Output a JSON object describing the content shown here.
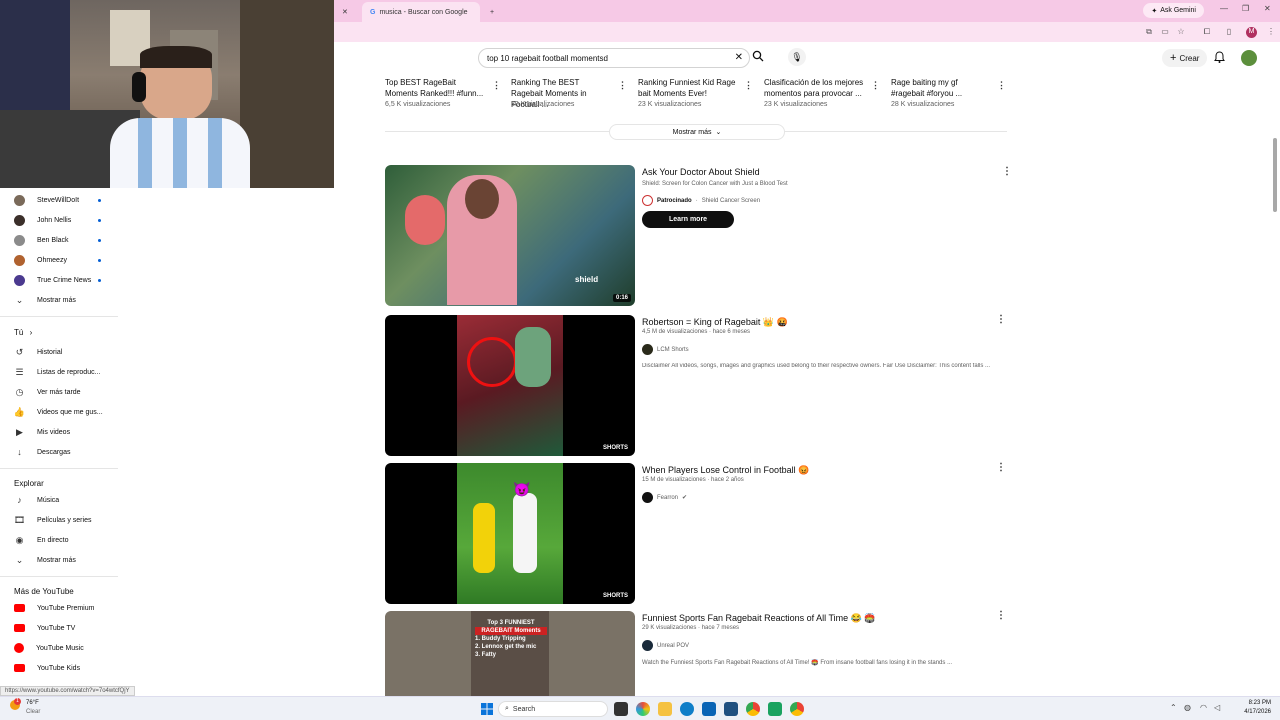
{
  "browser": {
    "tabs": [
      {
        "label": "Buscar con Google",
        "active": false,
        "prefix": "musica"
      },
      {
        "label": "×",
        "active": true
      }
    ],
    "gemini_label": "Ask Gemini",
    "new_tab": "+"
  },
  "youtube": {
    "search_value": "top 10 ragebait football momentsd",
    "create_label": "Crear",
    "shelf": [
      {
        "title": "Top BEST RageBait Moments Ranked!!! #funn...",
        "views": "6,5 K visualizaciones"
      },
      {
        "title": "Ranking The BEST Ragebait Moments in Football ...",
        "views": "30 K visualizaciones"
      },
      {
        "title": "Ranking Funniest Kid Rage bait Moments Ever!",
        "views": "23 K visualizaciones"
      },
      {
        "title": "Clasificación de los mejores momentos para provocar ...",
        "views": "23 K visualizaciones"
      },
      {
        "title": "Rage baiting my gf #ragebait #foryou ...",
        "views": "28 K visualizaciones"
      }
    ],
    "show_more": "Mostrar más",
    "results": [
      {
        "title": "Ask Your Doctor About Shield",
        "subtitle": "Shield: Screen for Colon Cancer with Just a Blood Test",
        "sponsor": "Patrocinado",
        "channel": "Shield Cancer Screen",
        "cta": "Learn more",
        "duration": "0:16"
      },
      {
        "title": "Robertson = King of Ragebait 👑 🤬",
        "meta": "4,5 M de visualizaciones · hace 6 meses",
        "channel": "LCM Shorts",
        "desc": "Disclaimer All videos, songs, images and graphics used belong to their respective owners. Fair Use Disclaimer: This content falls ...",
        "badge": "SHORTS"
      },
      {
        "title": "When Players Lose Control in Football 😡",
        "meta": "15 M de visualizaciones · hace 2 años",
        "channel": "Fearron",
        "badge": "SHORTS"
      },
      {
        "title": "Funniest Sports Fan Ragebait Reactions of All Time 😂 🏟️",
        "meta": "29 K visualizaciones · hace 7 meses",
        "channel": "Unreal POV",
        "desc": "Watch the Funniest Sports Fan Ragebait Reactions of All Time! 🏟️ From insane football fans losing it in the stands ...",
        "thumb_text": [
          "Top 3 FUNNIEST",
          "RAGEBAIT Moments",
          "1. Buddy Tripping",
          "2. Lennox get the mic",
          "3. Fatty"
        ]
      }
    ]
  },
  "sidebar": {
    "subscriptions": [
      {
        "name": "SteveWillDoIt",
        "color": "#7a6a5a"
      },
      {
        "name": "John Nellis",
        "color": "#3b2f2a"
      },
      {
        "name": "Ben Black",
        "color": "#8b8b8b"
      },
      {
        "name": "Ohmeezy",
        "color": "#b0622f"
      },
      {
        "name": "True Crime News",
        "color": "#4b3a8f"
      }
    ],
    "show_more_1": "Mostrar más",
    "you_heading": "Tú",
    "you_items": [
      "Historial",
      "Listas de reproduc...",
      "Ver más tarde",
      "Videos que me gus...",
      "Mis videos",
      "Descargas"
    ],
    "explore_heading": "Explorar",
    "explore_items": [
      "Música",
      "Películas y series",
      "En directo"
    ],
    "show_more_2": "Mostrar más",
    "more_heading": "Más de YouTube",
    "more_items": [
      "YouTube Premium",
      "YouTube TV",
      "YouTube Music",
      "YouTube Kids"
    ]
  },
  "status_url": "https://www.youtube.com/watch?v=7o4wtcfQjY",
  "taskbar": {
    "weather_temp": "76°F",
    "weather_desc": "Clear",
    "search_label": "Search",
    "time": "8:23 PM",
    "date": "4/17/2026"
  },
  "colors": {
    "brand": "#ff0000",
    "tab_bg": "#f6c9e6",
    "link": "#065fd4"
  }
}
